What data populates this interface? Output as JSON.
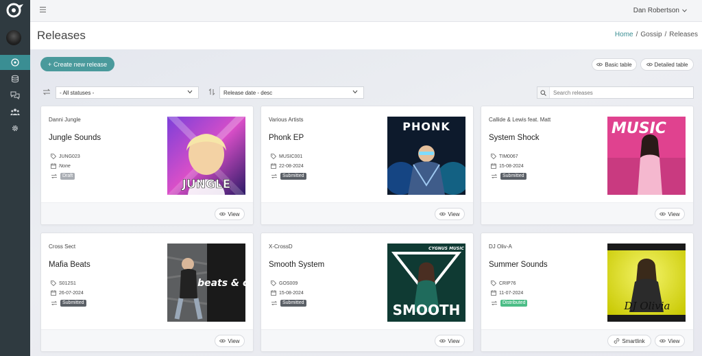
{
  "user": {
    "name": "Dan Robertson"
  },
  "header": {
    "title": "Releases",
    "breadcrumb": [
      "Home",
      "Gossip",
      "Releases"
    ],
    "breadcrumb_sep": "/"
  },
  "toolbar": {
    "create_label": "Create new release",
    "basic_table": "Basic table",
    "detailed_table": "Detailed table"
  },
  "filters": {
    "status_value": "- All statuses -",
    "sort_value": "Release date - desc",
    "search_placeholder": "Search releases"
  },
  "colors": {
    "accent": "#4a9a9c",
    "sidebar": "#2f3a40",
    "submitted": "#5a5f66",
    "draft": "#a9adb3",
    "distributed": "#4bbd86"
  },
  "cards": [
    {
      "artist": "Danni Jungle",
      "title": "Jungle Sounds",
      "code": "JUNG023",
      "date": "None",
      "status": "Draft",
      "status_type": "draft",
      "cover_text": "JUNGLE",
      "view_label": "View"
    },
    {
      "artist": "Various Artists",
      "title": "Phonk EP",
      "code": "MUSIC001",
      "date": "22-08-2024",
      "status": "Submitted",
      "status_type": "submitted",
      "cover_text": "PHONK",
      "view_label": "View"
    },
    {
      "artist": "Callide & Lewis feat. Matt",
      "title": "System Shock",
      "code": "TIM0067",
      "date": "15-08-2024",
      "status": "Submitted",
      "status_type": "submitted",
      "cover_text": "MUSIC",
      "view_label": "View"
    },
    {
      "artist": "Cross Sect",
      "title": "Mafia Beats",
      "code": "S012S1",
      "date": "26-07-2024",
      "status": "Submitted",
      "status_type": "submitted",
      "cover_text": "beats & co",
      "view_label": "View"
    },
    {
      "artist": "X-CrossD",
      "title": "Smooth System",
      "code": "GOS009",
      "date": "15-08-2024",
      "status": "Submitted",
      "status_type": "submitted",
      "cover_text": "SMOOTH",
      "cover_sub": "CYGNUS MUSIC",
      "view_label": "View"
    },
    {
      "artist": "DJ Oliv-A",
      "title": "Summer Sounds",
      "code": "CRIP76",
      "date": "11-07-2024",
      "status": "Distributed",
      "status_type": "distributed",
      "cover_text": "DJ Olivia",
      "view_label": "View",
      "smartlink_label": "Smartlink"
    }
  ]
}
